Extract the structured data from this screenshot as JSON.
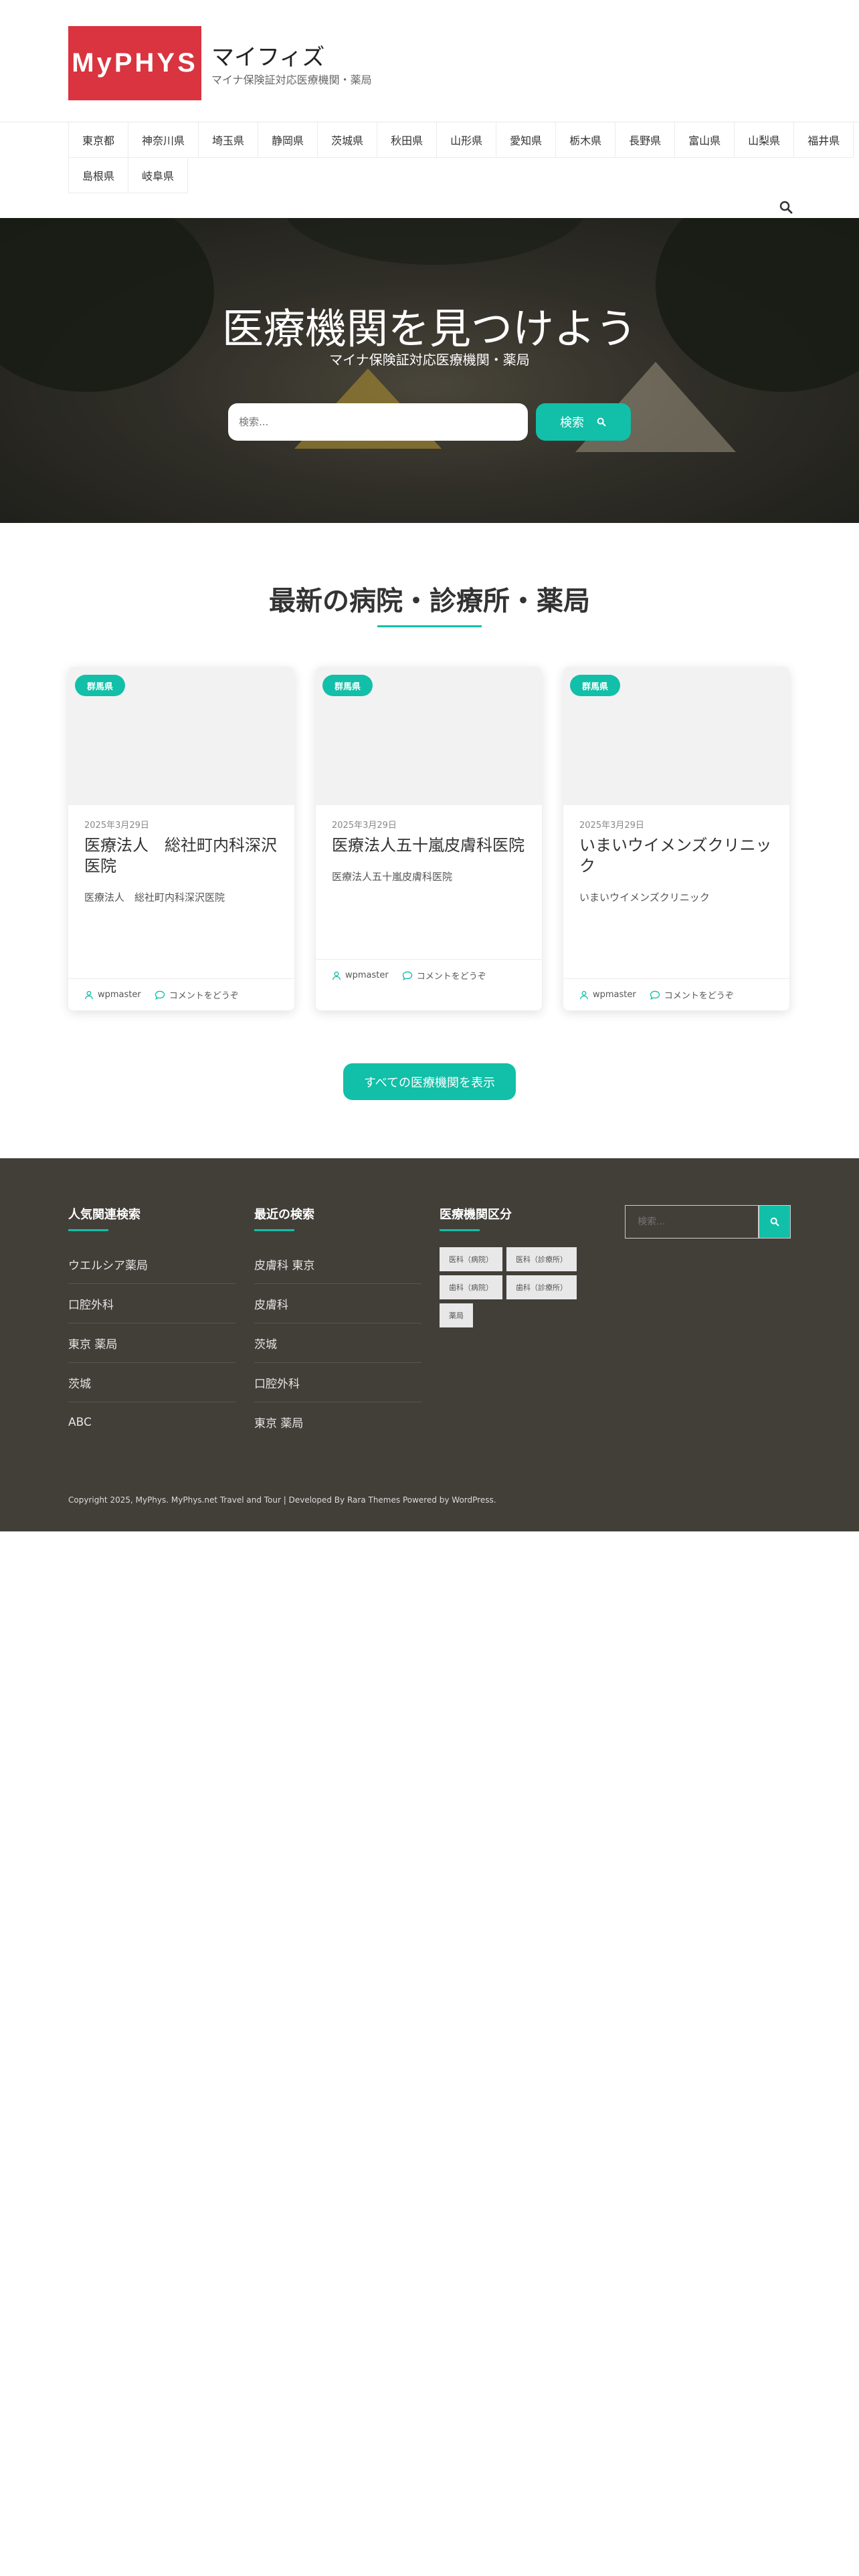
{
  "header": {
    "logo_text": "MyPHYS",
    "site_title": "マイフィズ",
    "site_description": "マイナ保険証対応医療機関・薬局"
  },
  "nav": {
    "rows": [
      [
        "東京都",
        "神奈川県",
        "埼玉県",
        "静岡県",
        "茨城県",
        "秋田県",
        "山形県",
        "愛知県",
        "栃木県",
        "長野県",
        "富山県",
        "山梨県",
        "福井県"
      ],
      [
        "島根県",
        "岐阜県"
      ]
    ],
    "search_icon": "search-icon"
  },
  "hero": {
    "title": "医療機関を見つけよう",
    "subtitle": "マイナ保険証対応医療機関・薬局",
    "search_placeholder": "検索...",
    "search_button": "検索"
  },
  "latest": {
    "title": "最新の病院・診療所・薬局",
    "cards": [
      {
        "badge": "群馬県",
        "date": "2025年3月29日",
        "title": "医療法人　総社町内科深沢医院",
        "excerpt": "医療法人　総社町内科深沢医院",
        "author": "wpmaster",
        "comments": "コメントをどうぞ"
      },
      {
        "badge": "群馬県",
        "date": "2025年3月29日",
        "title": "医療法人五十嵐皮膚科医院",
        "excerpt": "医療法人五十嵐皮膚科医院",
        "author": "wpmaster",
        "comments": "コメントをどうぞ"
      },
      {
        "badge": "群馬県",
        "date": "2025年3月29日",
        "title": "いまいウイメンズクリニック",
        "excerpt": "いまいウイメンズクリニック",
        "author": "wpmaster",
        "comments": "コメントをどうぞ"
      }
    ],
    "all_button": "すべての医療機関を表示"
  },
  "footer": {
    "popular": {
      "heading": "人気関連検索",
      "links": [
        "ウエルシア薬局",
        "口腔外科",
        "東京 薬局",
        "茨城",
        "ABC"
      ]
    },
    "recent": {
      "heading": "最近の検索",
      "links": [
        "皮膚科 東京",
        "皮膚科",
        "茨城",
        "口腔外科",
        "東京 薬局"
      ]
    },
    "categories": {
      "heading": "医療機関区分",
      "tags": [
        "医科（病院）",
        "医科（診療所）",
        "歯科（病院）",
        "歯科（診療所）",
        "薬局"
      ]
    },
    "search_placeholder": "検索...",
    "copyright": "Copyright 2025, MyPhys. MyPhys.net Travel and Tour | Developed By Rara Themes Powered by WordPress."
  },
  "colors": {
    "accent": "#12bfa8",
    "logo": "#d9343f",
    "footer": "#423e38"
  }
}
